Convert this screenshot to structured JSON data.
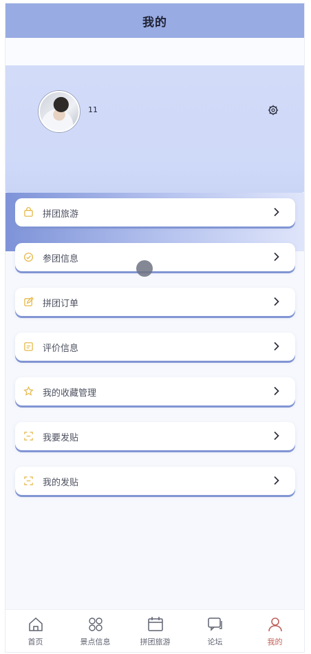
{
  "header": {
    "title": "我的"
  },
  "profile": {
    "username": "11",
    "settings_icon": "settings-icon",
    "avatar_icon": "avatar-photo"
  },
  "menu": [
    {
      "label": "拼团旅游",
      "icon": "bag-icon"
    },
    {
      "label": "参团信息",
      "icon": "check-circle-icon"
    },
    {
      "label": "拼团订单",
      "icon": "edit-icon"
    },
    {
      "label": "评价信息",
      "icon": "comment-icon"
    },
    {
      "label": "我的收藏管理",
      "icon": "star-icon"
    },
    {
      "label": "我要发贴",
      "icon": "post-icon"
    },
    {
      "label": "我的发贴",
      "icon": "post-icon"
    }
  ],
  "tabbar": [
    {
      "label": "首页",
      "icon": "home-icon"
    },
    {
      "label": "景点信息",
      "icon": "grid-icon"
    },
    {
      "label": "拼团旅游",
      "icon": "calendar-icon"
    },
    {
      "label": "论坛",
      "icon": "chat-icon"
    },
    {
      "label": "我的",
      "icon": "user-icon",
      "active": true
    }
  ],
  "colors": {
    "header": "#98abe3",
    "accent_icon": "#e6b84a",
    "active_tab": "#c0615a",
    "card_shadow": "#8195d3"
  }
}
